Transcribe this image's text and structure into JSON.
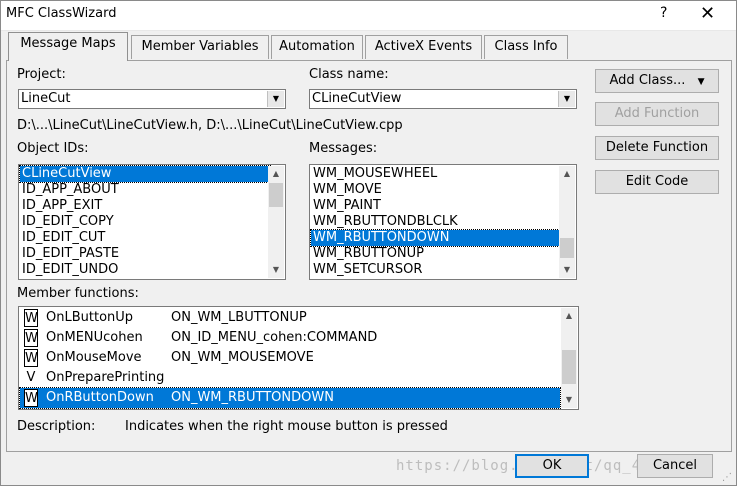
{
  "window": {
    "title": "MFC ClassWizard",
    "help_glyph": "?",
    "close_glyph": "✕"
  },
  "tabs": [
    {
      "label": "Message Maps",
      "active": true
    },
    {
      "label": "Member Variables",
      "active": false
    },
    {
      "label": "Automation",
      "active": false
    },
    {
      "label": "ActiveX Events",
      "active": false
    },
    {
      "label": "Class Info",
      "active": false
    }
  ],
  "project": {
    "label": "Project:",
    "value": "LineCut"
  },
  "class_name": {
    "label": "Class name:",
    "value": "CLineCutView"
  },
  "file_path": "D:\\...\\LineCut\\LineCutView.h, D:\\...\\LineCut\\LineCutView.cpp",
  "object_ids": {
    "label": "Object IDs:",
    "items": [
      "CLineCutView",
      "ID_APP_ABOUT",
      "ID_APP_EXIT",
      "ID_EDIT_COPY",
      "ID_EDIT_CUT",
      "ID_EDIT_PASTE",
      "ID_EDIT_UNDO"
    ],
    "selected_index": 0
  },
  "messages": {
    "label": "Messages:",
    "items": [
      "WM_MOUSEWHEEL",
      "WM_MOVE",
      "WM_PAINT",
      "WM_RBUTTONDBLCLK",
      "WM_RBUTTONDOWN",
      "WM_RBUTTONUP",
      "WM_SETCURSOR"
    ],
    "selected_index": 4
  },
  "buttons": {
    "add_class": "Add Class...",
    "add_function": "Add Function",
    "delete_function": "Delete Function",
    "edit_code": "Edit Code",
    "ok": "OK",
    "cancel": "Cancel"
  },
  "member_functions": {
    "label": "Member functions:",
    "rows": [
      {
        "type": "W",
        "name": "OnLButtonUp",
        "map": "ON_WM_LBUTTONUP"
      },
      {
        "type": "W",
        "name": "OnMENUcohen",
        "map": "ON_ID_MENU_cohen:COMMAND"
      },
      {
        "type": "W",
        "name": "OnMouseMove",
        "map": "ON_WM_MOUSEMOVE"
      },
      {
        "type": "V",
        "name": "OnPreparePrinting",
        "map": ""
      },
      {
        "type": "W",
        "name": "OnRButtonDown",
        "map": "ON_WM_RBUTTONDOWN"
      }
    ],
    "selected_index": 4
  },
  "description": {
    "label": "Description:",
    "text": "Indicates when the right mouse button is pressed"
  },
  "watermark": "https://blog.csdn.net/qq_41722340"
}
